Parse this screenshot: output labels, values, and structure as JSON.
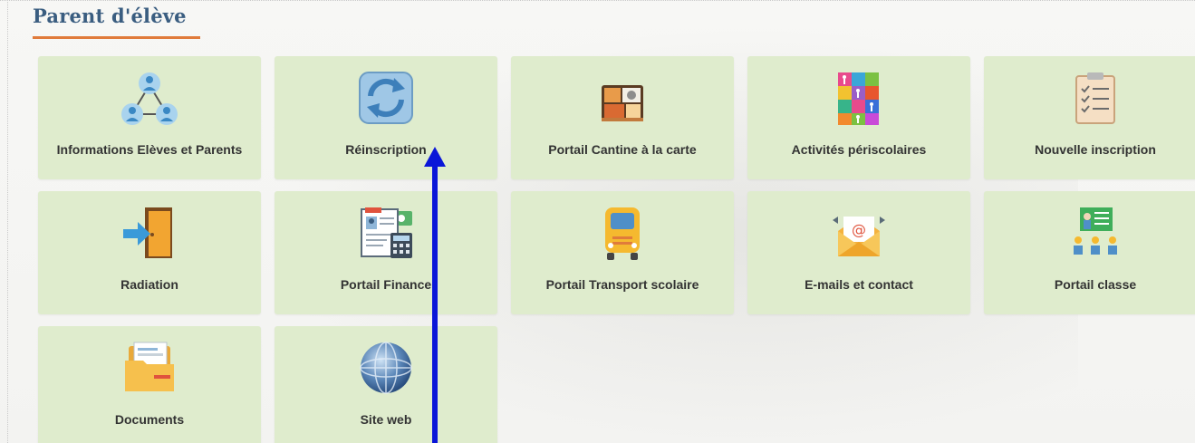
{
  "header": {
    "title": "Parent d'élève"
  },
  "tiles": [
    {
      "label": "Informations Elèves et Parents",
      "icon": "family-network-icon"
    },
    {
      "label": "Réinscription",
      "icon": "refresh-icon"
    },
    {
      "label": "Portail Cantine à la carte",
      "icon": "bento-box-icon"
    },
    {
      "label": "Activités périscolaires",
      "icon": "activities-grid-icon"
    },
    {
      "label": "Nouvelle inscription",
      "icon": "clipboard-checklist-icon"
    },
    {
      "label": "Radiation",
      "icon": "exit-door-icon"
    },
    {
      "label": "Portail Finance",
      "icon": "invoice-calculator-icon"
    },
    {
      "label": "Portail Transport scolaire",
      "icon": "school-bus-icon"
    },
    {
      "label": "E-mails et contact",
      "icon": "email-envelope-icon"
    },
    {
      "label": "Portail classe",
      "icon": "classroom-board-icon"
    },
    {
      "label": "Documents",
      "icon": "folder-documents-icon"
    },
    {
      "label": "Site web",
      "icon": "globe-icon"
    }
  ],
  "colors": {
    "tile_bg": "#dfeccd",
    "title": "#3a5d80",
    "title_underline": "#e07b3b",
    "annotation_arrow": "#0a16d8"
  }
}
